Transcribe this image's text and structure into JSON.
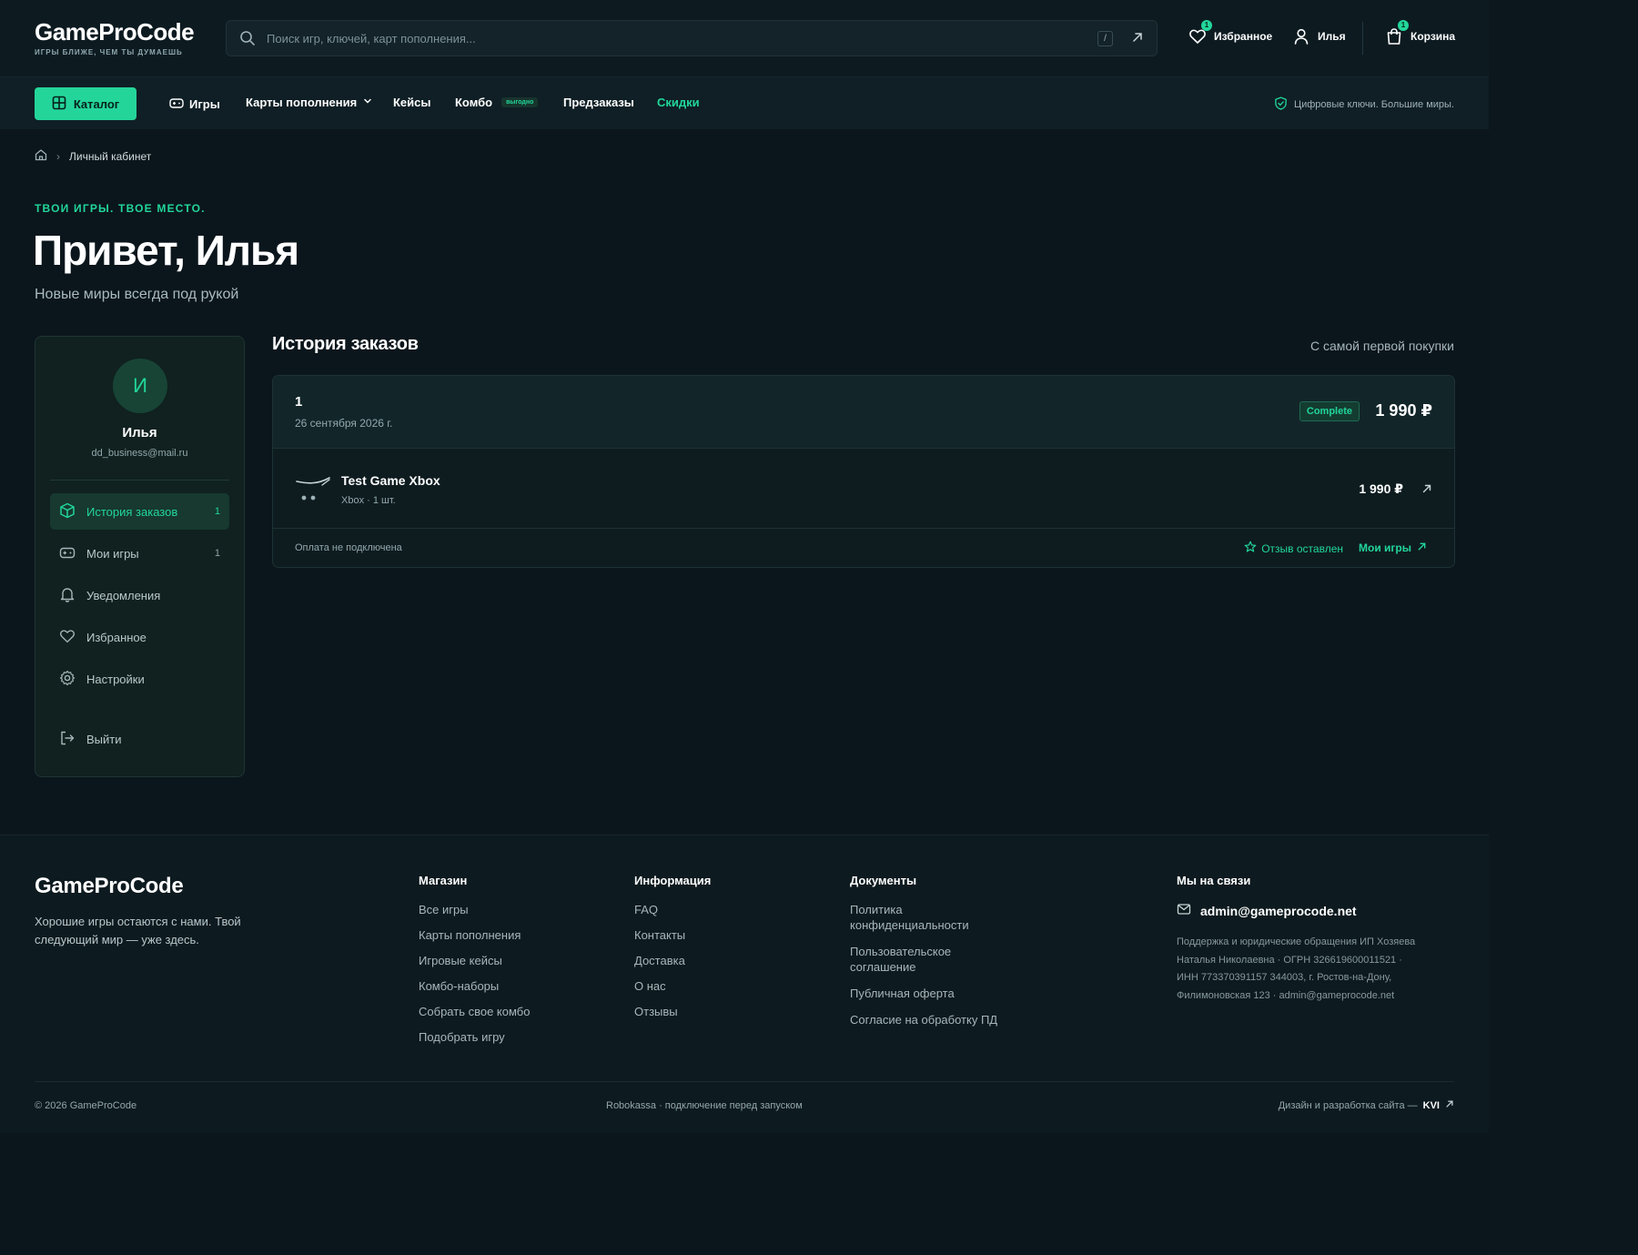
{
  "header": {
    "logo_title": "GameProCode",
    "logo_tagline": "ИГРЫ БЛИЖЕ, ЧЕМ ТЫ ДУМАЕШЬ",
    "search_placeholder": "Поиск игр, ключей, карт пополнения...",
    "search_shortcut": "/",
    "favorites_label": "Избранное",
    "favorites_count": "1",
    "user_label": "Илья",
    "cart_label": "Корзина",
    "cart_count": "1"
  },
  "nav": {
    "catalog_label": "Каталог",
    "links": [
      "Игры",
      "Карты пополнения",
      "Кейсы",
      "Комбо",
      "Предзаказы",
      "Скидки"
    ],
    "combo_badge": "выгодно",
    "tagline": "Цифровые ключи. Большие миры."
  },
  "breadcrumb": {
    "current": "Личный кабинет"
  },
  "hero": {
    "eyebrow": "ТВОИ ИГРЫ. ТВОЕ МЕСТО.",
    "title": "Привет, Илья",
    "subtitle": "Новые миры всегда под рукой"
  },
  "sidebar": {
    "avatar_letter": "И",
    "name": "Илья",
    "email": "dd_business@mail.ru",
    "items": [
      {
        "label": "История заказов",
        "count": "1",
        "icon": "box-icon"
      },
      {
        "label": "Мои игры",
        "count": "1",
        "icon": "gamepad-icon"
      },
      {
        "label": "Уведомления",
        "count": "",
        "icon": "bell-icon"
      },
      {
        "label": "Избранное",
        "count": "",
        "icon": "heart-icon"
      },
      {
        "label": "Настройки",
        "count": "",
        "icon": "gear-icon"
      }
    ],
    "logout_label": "Выйти"
  },
  "orders": {
    "title": "История заказов",
    "note": "С самой первой покупки",
    "order": {
      "number": "1",
      "date": "26 сентября 2026 г.",
      "status": "Complete",
      "total": "1 990 ₽",
      "item_name": "Test Game Xbox",
      "item_meta": "Xbox · 1 шт.",
      "item_price": "1 990 ₽",
      "payment_note": "Оплата не подключена",
      "review_label": "Отзыв оставлен",
      "my_games_label": "Мои игры"
    }
  },
  "footer": {
    "logo": "GameProCode",
    "tagline": "Хорошие игры остаются с нами. Твой следующий мир — уже здесь.",
    "shop_title": "Магазин",
    "shop_links": [
      "Все игры",
      "Карты пополнения",
      "Игровые кейсы",
      "Комбо-наборы",
      "Собрать свое комбо",
      "Подобрать игру"
    ],
    "info_title": "Информация",
    "info_links": [
      "FAQ",
      "Контакты",
      "Доставка",
      "О нас",
      "Отзывы"
    ],
    "docs_title": "Документы",
    "docs_links": [
      "Политика конфиденциальности",
      "Пользовательское соглашение",
      "Публичная оферта",
      "Согласие на обработку ПД"
    ],
    "contact_title": "Мы на связи",
    "contact_email": "admin@gameprocode.net",
    "contact_text": "Поддержка и юридические обращения ИП Хозяева Наталья Николаевна · ОГРН 326619600011521 · ИНН 773370391157 344003, г. Ростов-на-Дону, Филимоновская 123 · admin@gameprocode.net",
    "copyright": "© 2026 GameProCode",
    "payment": "Robokassa · подключение перед запуском",
    "dev_prefix": "Дизайн и разработка сайта —",
    "dev_name": "KVI"
  },
  "colors": {
    "accent": "#22d69a",
    "background": "#0b161c",
    "card": "#10211f"
  }
}
